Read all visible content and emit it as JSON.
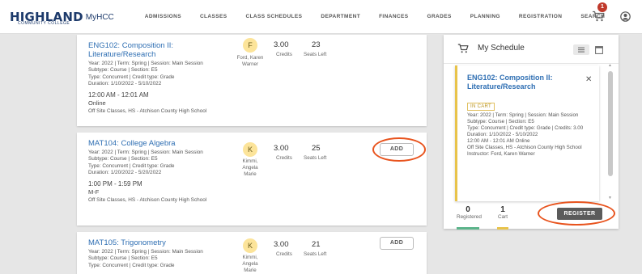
{
  "header": {
    "logo_main": "HIGHLAND",
    "logo_sub": "COMMUNITY COLLEGE",
    "logo_my": "MyHCC",
    "nav": [
      "ADMISSIONS",
      "CLASSES",
      "CLASS SCHEDULES",
      "DEPARTMENT",
      "FINANCES",
      "GRADES",
      "PLANNING",
      "REGISTRATION",
      "SEARCH"
    ],
    "cart_count": "1"
  },
  "courses": [
    {
      "title": "ENG102: Composition II: Literature/Research",
      "meta1": "Year: 2022 | Term: Spring | Session: Main Session",
      "meta2": "Subtype: Course | Section: E5",
      "meta3": "Type: Concurrent | Credit type: Grade",
      "meta4": "Duration: 1/10/2022 - 5/10/2022",
      "time": "12:00 AM - 12:01 AM",
      "days": "Online",
      "location": "Off Site Classes, HS - Atchison County High School",
      "badge": "F",
      "instructor": "Ford, Karen Warner",
      "credits": "3.00",
      "credits_label": "Credits",
      "seats": "23",
      "seats_label": "Seats Left"
    },
    {
      "title": "MAT104: College Algebra",
      "meta1": "Year: 2022 | Term: Spring | Session: Main Session",
      "meta2": "Subtype: Course | Section: E5",
      "meta3": "Type: Concurrent | Credit type: Grade",
      "meta4": "Duration: 1/20/2022 - 5/20/2022",
      "time": "1:00 PM - 1:59 PM",
      "days": "M-F",
      "location": "Off Site Classes, HS - Atchison County High School",
      "badge": "K",
      "instructor": "Kimmi, Angela Marie",
      "credits": "3.00",
      "credits_label": "Credits",
      "seats": "25",
      "seats_label": "Seats Left",
      "add_label": "ADD"
    },
    {
      "title": "MAT105: Trigonometry",
      "meta1": "Year: 2022 | Term: Spring | Session: Main Session",
      "meta2": "Subtype: Course | Section: E5",
      "meta3": "Type: Concurrent | Credit type: Grade",
      "badge": "K",
      "instructor": "Kimmi, Angela Marie",
      "credits": "3.00",
      "credits_label": "Credits",
      "seats": "21",
      "seats_label": "Seats Left",
      "add_label": "ADD"
    }
  ],
  "schedule": {
    "title": "My Schedule",
    "item": {
      "title": "ENG102: Composition II: Literature/Research",
      "status": "IN CART",
      "details": [
        "Year: 2022 | Term: Spring | Session: Main Session",
        "Subtype: Course | Section: E5",
        "Type: Concurrent | Credit type: Grade | Credits: 3.00",
        "Duration: 1/10/2022 - 5/10/2022",
        "12:00 AM - 12:01 AM Online",
        "Off Site Classes, HS - Atchison County High School",
        "Instructor: Ford, Karen Warner"
      ]
    },
    "registered_count": "0",
    "registered_label": "Registered",
    "cart_count": "1",
    "cart_label": "Cart",
    "register_label": "REGISTER"
  },
  "colors": {
    "link_blue": "#2f6fb3",
    "highlight_orange": "#e8531d",
    "badge_yellow": "#fce49a",
    "cart_accent": "#e8c34a",
    "registered_green": "#5bb48a"
  }
}
